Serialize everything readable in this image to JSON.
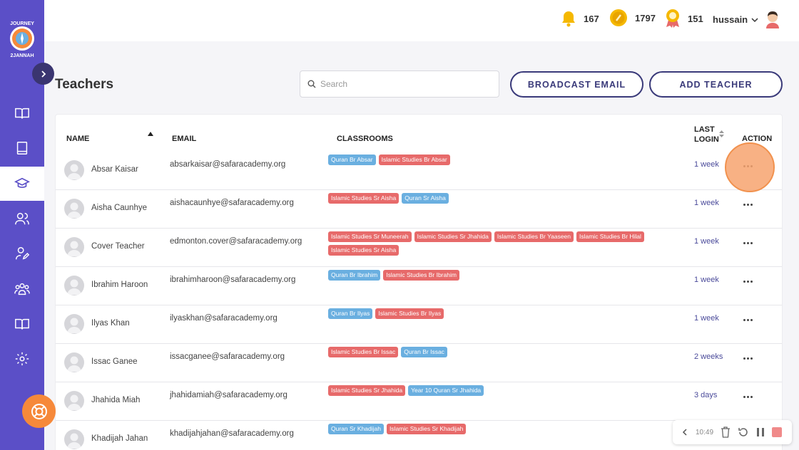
{
  "header": {
    "notifications_count": "167",
    "coins_count": "1797",
    "badges_count": "151",
    "username": "hussain"
  },
  "page": {
    "title": "Teachers",
    "search_placeholder": "Search",
    "broadcast_label": "BROADCAST EMAIL",
    "add_teacher_label": "ADD TEACHER"
  },
  "table": {
    "headers": {
      "name": "NAME",
      "email": "EMAIL",
      "classrooms": "CLASSROOMS",
      "last_login_1": "LAST",
      "last_login_2": "LOGIN",
      "action": "ACTION"
    },
    "rows": [
      {
        "name": "Absar Kaisar",
        "email": "absarkaisar@safaracademy.org",
        "last_login": "1 week",
        "tags": [
          {
            "text": "Quran Br Absar",
            "color": "blue"
          },
          {
            "text": "Islamic Studies Br Absar",
            "color": "red"
          }
        ]
      },
      {
        "name": "Aisha Caunhye",
        "email": "aishacaunhye@safaracademy.org",
        "last_login": "1 week",
        "tags": [
          {
            "text": "Islamic Studies Sr Aisha",
            "color": "red"
          },
          {
            "text": "Quran Sr Aisha",
            "color": "blue"
          }
        ]
      },
      {
        "name": "Cover Teacher",
        "email": "edmonton.cover@safaracademy.org",
        "last_login": "1 week",
        "tags": [
          {
            "text": "Islamic Studies Sr Muneerah",
            "color": "red"
          },
          {
            "text": "Islamic Studies Sr Jhahida",
            "color": "red"
          },
          {
            "text": "Islamic Studies Br Yaaseen",
            "color": "red"
          },
          {
            "text": "Islamic Studies Br Hilal",
            "color": "red"
          },
          {
            "text": "Islamic Studies Sr Aisha",
            "color": "red"
          }
        ]
      },
      {
        "name": "Ibrahim Haroon",
        "email": "ibrahimharoon@safaracademy.org",
        "last_login": "1 week",
        "tags": [
          {
            "text": "Quran Br Ibrahim",
            "color": "blue"
          },
          {
            "text": "Islamic Studies Br Ibrahim",
            "color": "red"
          }
        ]
      },
      {
        "name": "Ilyas Khan",
        "email": "ilyaskhan@safaracademy.org",
        "last_login": "1 week",
        "tags": [
          {
            "text": "Quran Br Ilyas",
            "color": "blue"
          },
          {
            "text": "Islamic Studies Br Ilyas",
            "color": "red"
          }
        ]
      },
      {
        "name": "Issac Ganee",
        "email": "issacganee@safaracademy.org",
        "last_login": "2 weeks",
        "tags": [
          {
            "text": "Islamic Studies Br Issac",
            "color": "red"
          },
          {
            "text": "Quran Br Issac",
            "color": "blue"
          }
        ]
      },
      {
        "name": "Jhahida Miah",
        "email": "jhahidamiah@safaracademy.org",
        "last_login": "3 days",
        "tags": [
          {
            "text": "Islamic Studies Sr Jhahida",
            "color": "red"
          },
          {
            "text": "Year 10 Quran Sr Jhahida",
            "color": "blue"
          }
        ]
      },
      {
        "name": "Khadijah Jahan",
        "email": "khadijahjahan@safaracademy.org",
        "last_login": "",
        "tags": [
          {
            "text": "Quran Sr Khadijah",
            "color": "blue"
          },
          {
            "text": "Islamic Studies Sr Khadijah",
            "color": "red"
          }
        ]
      }
    ]
  },
  "recorder": {
    "time": "10:49"
  },
  "colors": {
    "sidebar": "#5b4fc7",
    "accent_navy": "#3a3a7a",
    "tag_blue": "#6aafe0",
    "tag_red": "#e76a6a",
    "highlight_orange": "#f6893a"
  },
  "icons": {
    "sidebar": [
      "open-book-icon",
      "book-icon",
      "graduation-cap-icon",
      "users-icon",
      "user-edit-icon",
      "group-icon",
      "open-book-icon",
      "gear-icon"
    ],
    "header": [
      "bell-icon",
      "coin-icon",
      "medal-icon",
      "chevron-down-icon"
    ]
  }
}
